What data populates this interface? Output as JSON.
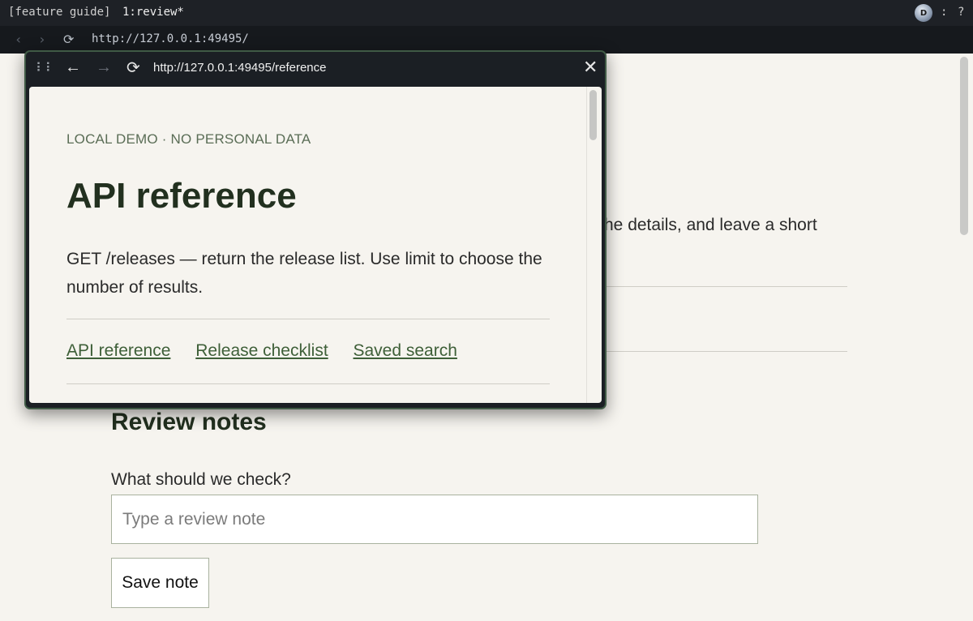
{
  "topbar": {
    "session": "[feature guide]",
    "window": "1:review*",
    "avatar_initial": "D",
    "more_label": ":",
    "help_label": "?"
  },
  "browser": {
    "back_icon": "chevron-left-icon",
    "forward_icon": "chevron-right-icon",
    "reload_icon": "reload-icon",
    "url": "http://127.0.0.1:49495/"
  },
  "page": {
    "intro_fragment": "he details, and leave a short",
    "notes_heading": "Review notes",
    "field_label": "What should we check?",
    "input_placeholder": "Type a review note",
    "input_value": "",
    "save_label": "Save note"
  },
  "popup": {
    "url": "http://127.0.0.1:49495/reference",
    "eyebrow": "LOCAL DEMO · NO PERSONAL DATA",
    "title": "API reference",
    "description": "GET /releases — return the release list. Use limit to choose the number of results.",
    "links": [
      "API reference",
      "Release checklist",
      "Saved search"
    ]
  },
  "colors": {
    "accent_green": "#22301f",
    "link_green": "#3e5f38",
    "page_bg": "#f6f4ef",
    "chrome_dark": "#1b1f24"
  }
}
